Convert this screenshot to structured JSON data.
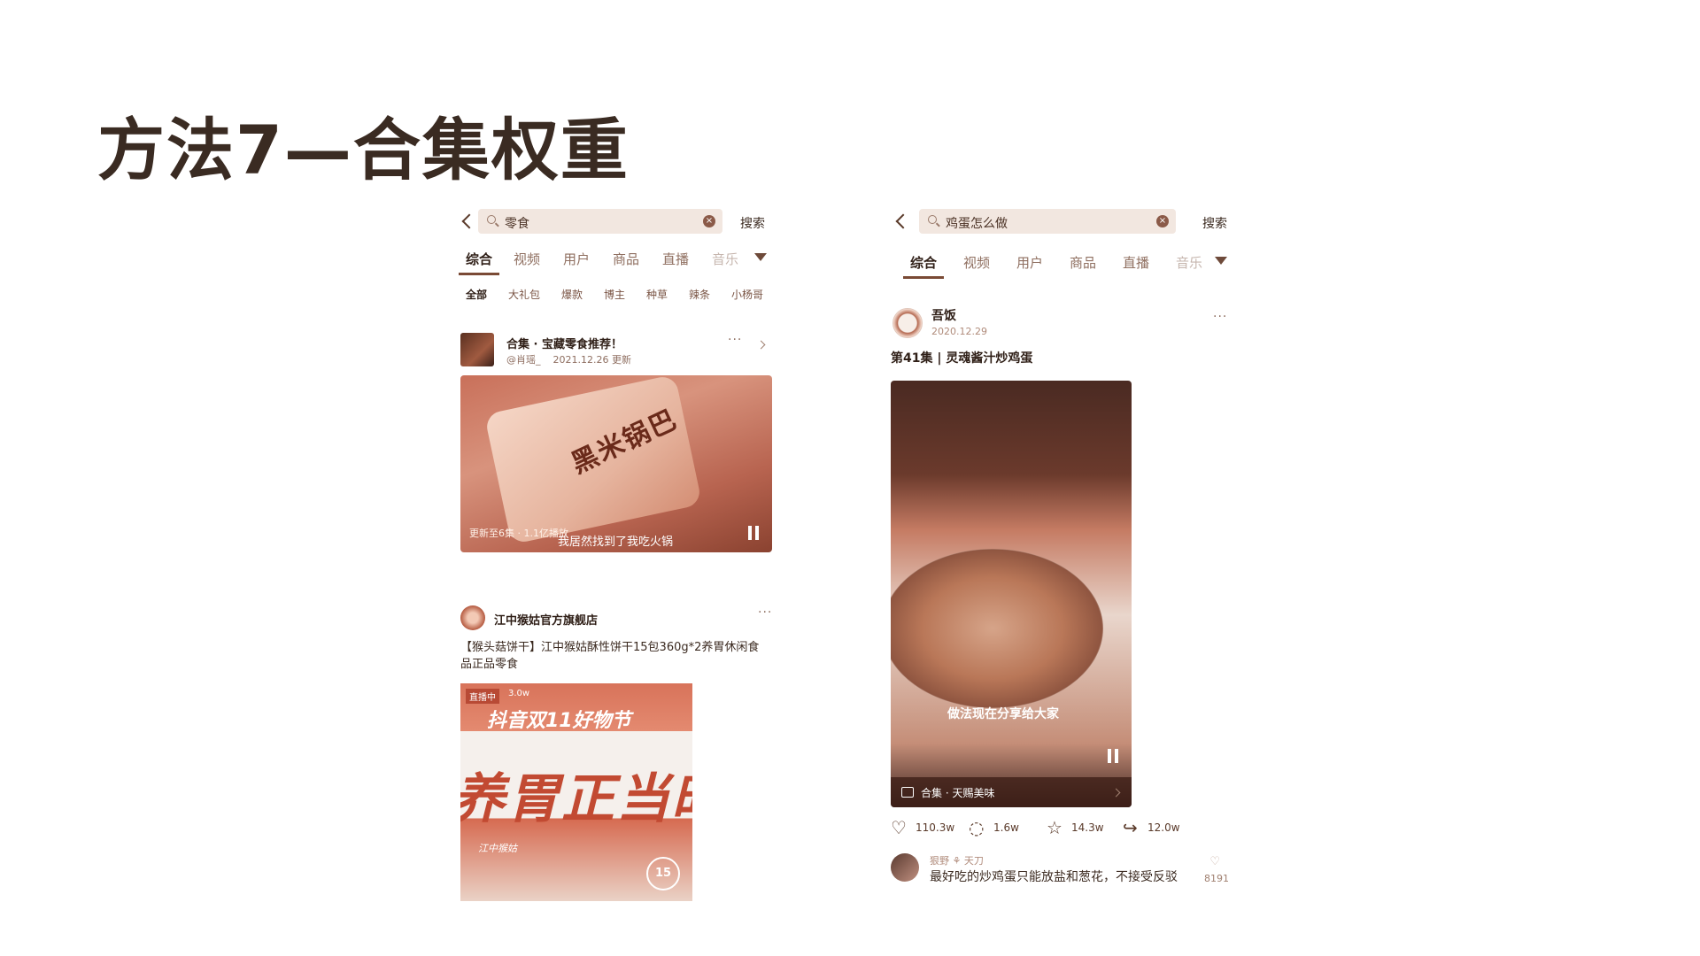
{
  "slide": {
    "title": "方法7—合集权重"
  },
  "left": {
    "search": {
      "query": "零食",
      "button": "搜索"
    },
    "tabs": [
      "综合",
      "视频",
      "用户",
      "商品",
      "直播",
      "音乐"
    ],
    "chips": [
      "全部",
      "大礼包",
      "爆款",
      "博主",
      "种草",
      "辣条",
      "小杨哥"
    ],
    "collection": {
      "title": "合集 · 宝藏零食推荐！",
      "author": "@肖瑶_",
      "updated": "2021.12.26 更新",
      "video_meta": "更新至6集 · 1.1亿播放",
      "video_subtitle": "我居然找到了我吃火锅",
      "package_text": "黑米锅巴"
    },
    "shop": {
      "name": "江中猴姑官方旗舰店",
      "product_title": "【猴头菇饼干】江中猴姑酥性饼干15包360g*2养胃休闲食品正品零食",
      "live_badge": "直播中",
      "live_views": "3.0w",
      "banner_top": "抖音双11好物节",
      "banner_big": "养胃正当时",
      "box_brand": "江中猴姑",
      "box_number": "15"
    }
  },
  "right": {
    "search": {
      "query": "鸡蛋怎么做",
      "button": "搜索"
    },
    "tabs": [
      "综合",
      "视频",
      "用户",
      "商品",
      "直播",
      "音乐"
    ],
    "author": {
      "name": "吾饭",
      "date": "2020.12.29"
    },
    "post_title": "第41集 | 灵魂酱汁炒鸡蛋",
    "video_subtitle": "做法现在分享给大家",
    "collection_bar": "合集 · 天赐美味",
    "actions": {
      "likes": "110.3w",
      "comments": "1.6w",
      "favorites": "14.3w",
      "shares": "12.0w"
    },
    "comment": {
      "user": "狠野 ⚘ 天刀",
      "text": "最好吃的炒鸡蛋只能放盐和葱花，不接受反驳",
      "likes": "8191"
    }
  },
  "icons": {
    "back": "chevron-left-icon",
    "search": "search-icon",
    "clear": "clear-icon",
    "filter": "filter-icon",
    "more": "more-icon",
    "pause": "pause-icon",
    "like": "heart-icon",
    "comment": "comment-icon",
    "favorite": "star-icon",
    "share": "share-icon"
  },
  "colors": {
    "accent": "#7a4a35",
    "text": "#3b2a20"
  }
}
